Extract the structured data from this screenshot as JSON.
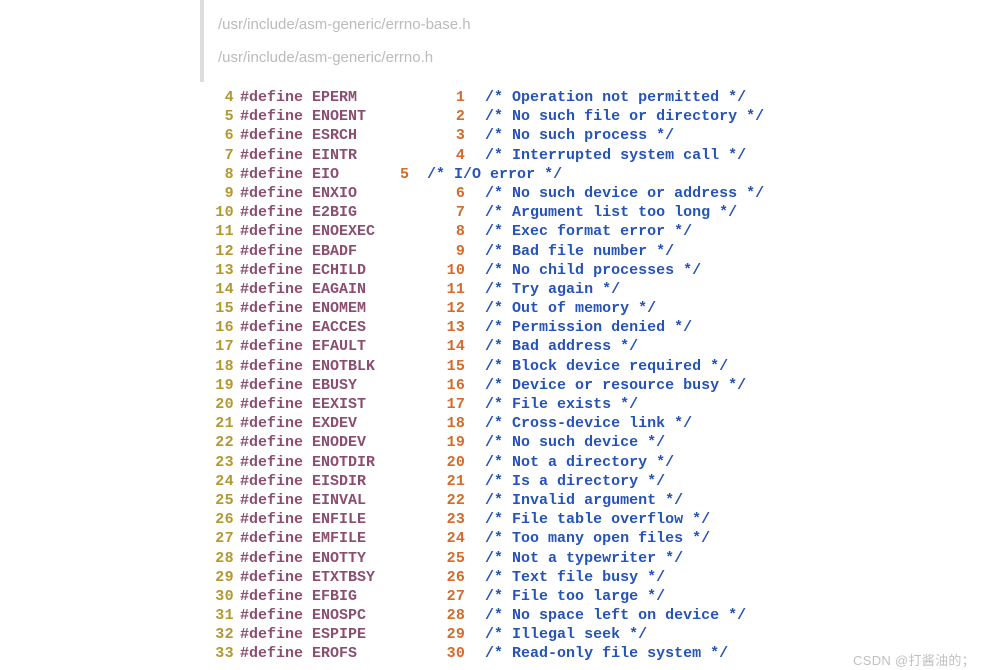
{
  "paths": [
    "/usr/include/asm-generic/errno-base.h",
    "/usr/include/asm-generic/errno.h"
  ],
  "rows": [
    {
      "ln": "4",
      "def": "#define",
      "name": "EPERM",
      "pad": 2,
      "val": "1",
      "alt": false,
      "cmt": "/* Operation not permitted */"
    },
    {
      "ln": "5",
      "def": "#define",
      "name": "ENOENT",
      "pad": 1,
      "val": "2",
      "alt": false,
      "cmt": "/* No such file or directory */"
    },
    {
      "ln": "6",
      "def": "#define",
      "name": "ESRCH",
      "pad": 2,
      "val": "3",
      "alt": false,
      "cmt": "/* No such process */"
    },
    {
      "ln": "7",
      "def": "#define",
      "name": "EINTR",
      "pad": 2,
      "val": "4",
      "alt": false,
      "cmt": "/* Interrupted system call */"
    },
    {
      "ln": "8",
      "def": "#define",
      "name": "EIO",
      "pad": 0,
      "val": "5",
      "alt": true,
      "cmt": "/* I/O error */"
    },
    {
      "ln": "9",
      "def": "#define",
      "name": "ENXIO",
      "pad": 2,
      "val": "6",
      "alt": false,
      "cmt": "/* No such device or address */"
    },
    {
      "ln": "10",
      "def": "#define",
      "name": "E2BIG",
      "pad": 2,
      "val": "7",
      "alt": false,
      "cmt": "/* Argument list too long */"
    },
    {
      "ln": "11",
      "def": "#define",
      "name": "ENOEXEC",
      "pad": 0,
      "val": "8",
      "alt": false,
      "cmt": "/* Exec format error */"
    },
    {
      "ln": "12",
      "def": "#define",
      "name": "EBADF",
      "pad": 2,
      "val": "9",
      "alt": false,
      "cmt": "/* Bad file number */"
    },
    {
      "ln": "13",
      "def": "#define",
      "name": "ECHILD",
      "pad": 1,
      "val": "10",
      "alt": false,
      "cmt": "/* No child processes */"
    },
    {
      "ln": "14",
      "def": "#define",
      "name": "EAGAIN",
      "pad": 1,
      "val": "11",
      "alt": false,
      "cmt": "/* Try again */"
    },
    {
      "ln": "15",
      "def": "#define",
      "name": "ENOMEM",
      "pad": 1,
      "val": "12",
      "alt": false,
      "cmt": "/* Out of memory */"
    },
    {
      "ln": "16",
      "def": "#define",
      "name": "EACCES",
      "pad": 1,
      "val": "13",
      "alt": false,
      "cmt": "/* Permission denied */"
    },
    {
      "ln": "17",
      "def": "#define",
      "name": "EFAULT",
      "pad": 1,
      "val": "14",
      "alt": false,
      "cmt": "/* Bad address */"
    },
    {
      "ln": "18",
      "def": "#define",
      "name": "ENOTBLK",
      "pad": 0,
      "val": "15",
      "alt": false,
      "cmt": "/* Block device required */"
    },
    {
      "ln": "19",
      "def": "#define",
      "name": "EBUSY",
      "pad": 2,
      "val": "16",
      "alt": false,
      "cmt": "/* Device or resource busy */"
    },
    {
      "ln": "20",
      "def": "#define",
      "name": "EEXIST",
      "pad": 1,
      "val": "17",
      "alt": false,
      "cmt": "/* File exists */"
    },
    {
      "ln": "21",
      "def": "#define",
      "name": "EXDEV",
      "pad": 2,
      "val": "18",
      "alt": false,
      "cmt": "/* Cross-device link */"
    },
    {
      "ln": "22",
      "def": "#define",
      "name": "ENODEV",
      "pad": 1,
      "val": "19",
      "alt": false,
      "cmt": "/* No such device */"
    },
    {
      "ln": "23",
      "def": "#define",
      "name": "ENOTDIR",
      "pad": 0,
      "val": "20",
      "alt": false,
      "cmt": "/* Not a directory */"
    },
    {
      "ln": "24",
      "def": "#define",
      "name": "EISDIR",
      "pad": 1,
      "val": "21",
      "alt": false,
      "cmt": "/* Is a directory */"
    },
    {
      "ln": "25",
      "def": "#define",
      "name": "EINVAL",
      "pad": 1,
      "val": "22",
      "alt": false,
      "cmt": "/* Invalid argument */"
    },
    {
      "ln": "26",
      "def": "#define",
      "name": "ENFILE",
      "pad": 1,
      "val": "23",
      "alt": false,
      "cmt": "/* File table overflow */"
    },
    {
      "ln": "27",
      "def": "#define",
      "name": "EMFILE",
      "pad": 1,
      "val": "24",
      "alt": false,
      "cmt": "/* Too many open files */"
    },
    {
      "ln": "28",
      "def": "#define",
      "name": "ENOTTY",
      "pad": 1,
      "val": "25",
      "alt": false,
      "cmt": "/* Not a typewriter */"
    },
    {
      "ln": "29",
      "def": "#define",
      "name": "ETXTBSY",
      "pad": 0,
      "val": "26",
      "alt": false,
      "cmt": "/* Text file busy */"
    },
    {
      "ln": "30",
      "def": "#define",
      "name": "EFBIG",
      "pad": 2,
      "val": "27",
      "alt": false,
      "cmt": "/* File too large */"
    },
    {
      "ln": "31",
      "def": "#define",
      "name": "ENOSPC",
      "pad": 1,
      "val": "28",
      "alt": false,
      "cmt": "/* No space left on device */"
    },
    {
      "ln": "32",
      "def": "#define",
      "name": "ESPIPE",
      "pad": 1,
      "val": "29",
      "alt": false,
      "cmt": "/* Illegal seek */"
    },
    {
      "ln": "33",
      "def": "#define",
      "name": "EROFS",
      "pad": 2,
      "val": "30",
      "alt": false,
      "cmt": "/* Read-only file system */"
    }
  ],
  "watermark": "CSDN @打酱油的；"
}
